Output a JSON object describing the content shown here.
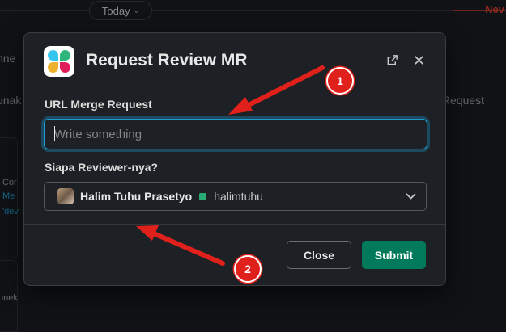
{
  "background": {
    "date_pill": "Today",
    "new_marker": "Nev",
    "fragments": {
      "f1": "nne",
      "f2": "unak",
      "f3": "v Request",
      "f4": "Cor",
      "f5": "Me",
      "f6": "'dev",
      "f7": "nnek"
    }
  },
  "modal": {
    "title": "Request Review MR",
    "url_field": {
      "label": "URL Merge Request",
      "placeholder": "Write something",
      "value": ""
    },
    "reviewer_field": {
      "label": "Siapa Reviewer-nya?",
      "selected_name": "Halim Tuhu Prasetyo",
      "selected_handle": "halimtuhu"
    },
    "buttons": {
      "close": "Close",
      "submit": "Submit"
    }
  },
  "annotations": {
    "badge_1": "1",
    "badge_2": "2"
  },
  "colors": {
    "accent_focus": "#1d9bd1",
    "submit_green": "#007a5a",
    "annotation_red": "#e0201b",
    "presence_green": "#2bac76"
  }
}
